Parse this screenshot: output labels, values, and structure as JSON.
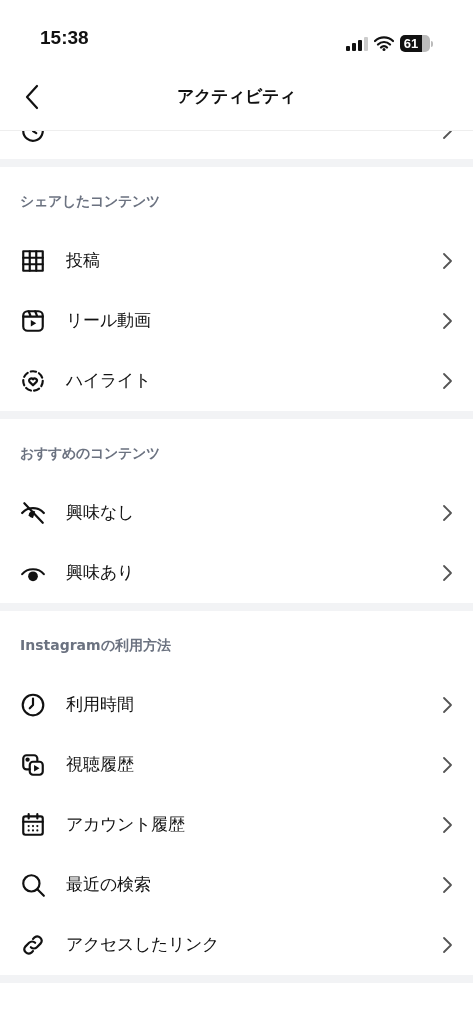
{
  "status_bar": {
    "time": "15:38",
    "battery": "61"
  },
  "header": {
    "title": "アクティビティ"
  },
  "clipped_row": {
    "kind": "archive"
  },
  "sections": [
    {
      "title": "シェアしたコンテンツ",
      "items": [
        {
          "kind": "grid",
          "label": "投稿"
        },
        {
          "kind": "reels",
          "label": "リール動画"
        },
        {
          "kind": "highlight",
          "label": "ハイライト"
        }
      ]
    },
    {
      "title": "おすすめのコンテンツ",
      "items": [
        {
          "kind": "eye-off",
          "label": "興味なし"
        },
        {
          "kind": "eye",
          "label": "興味あり"
        }
      ]
    },
    {
      "title": "Instagramの利用方法",
      "items": [
        {
          "kind": "clock",
          "label": "利用時間"
        },
        {
          "kind": "media",
          "label": "視聴履歴"
        },
        {
          "kind": "calendar",
          "label": "アカウント履歴"
        },
        {
          "kind": "search",
          "label": "最近の検索"
        },
        {
          "kind": "link",
          "label": "アクセスしたリンク"
        }
      ]
    }
  ]
}
